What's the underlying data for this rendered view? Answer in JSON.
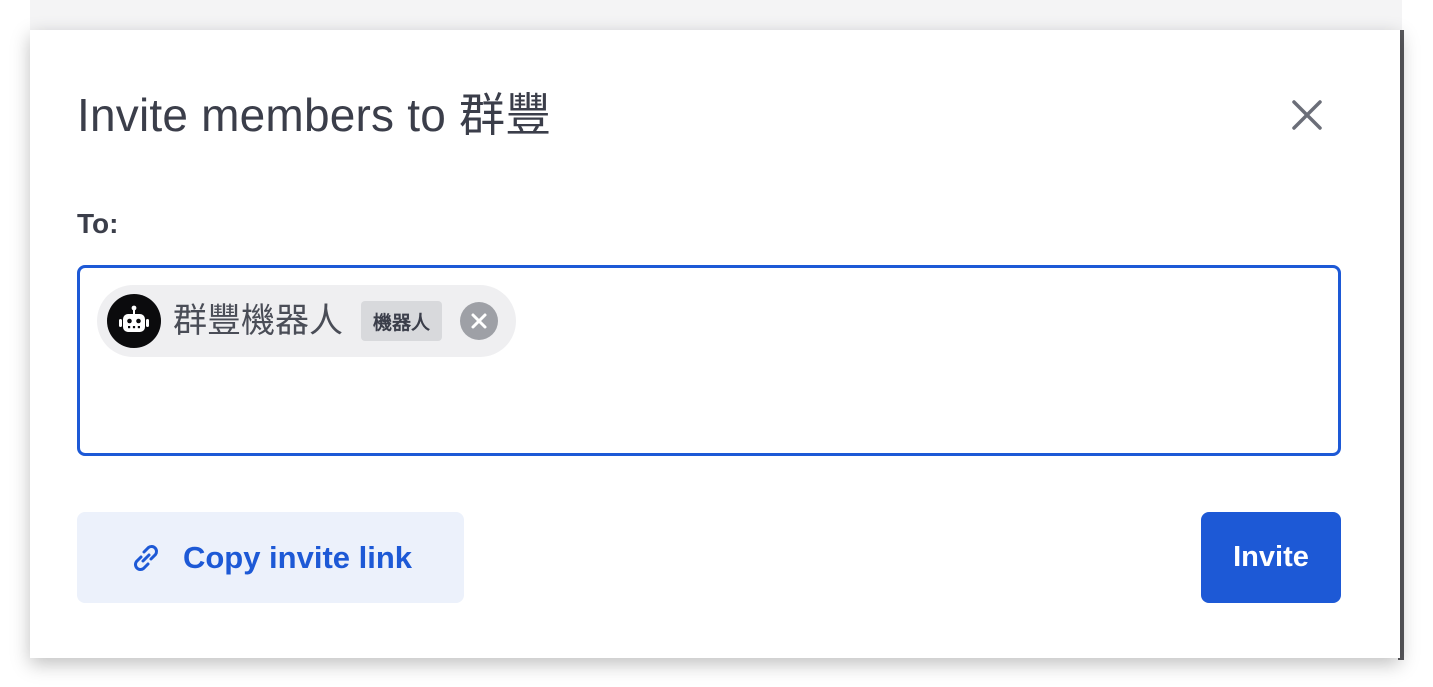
{
  "dialog": {
    "title": "Invite members to 群豐",
    "to_label": "To:"
  },
  "recipients": [
    {
      "name": "群豐機器人",
      "tag": "機器人",
      "avatar_icon": "robot-icon"
    }
  ],
  "actions": {
    "copy_link_label": "Copy invite link",
    "copy_link_icon": "link-icon",
    "invite_label": "Invite"
  },
  "colors": {
    "accent": "#1d59d6",
    "text": "#3b3e4a",
    "chip_bg": "#efeff1",
    "secondary_btn_bg": "#ecf1fb"
  }
}
